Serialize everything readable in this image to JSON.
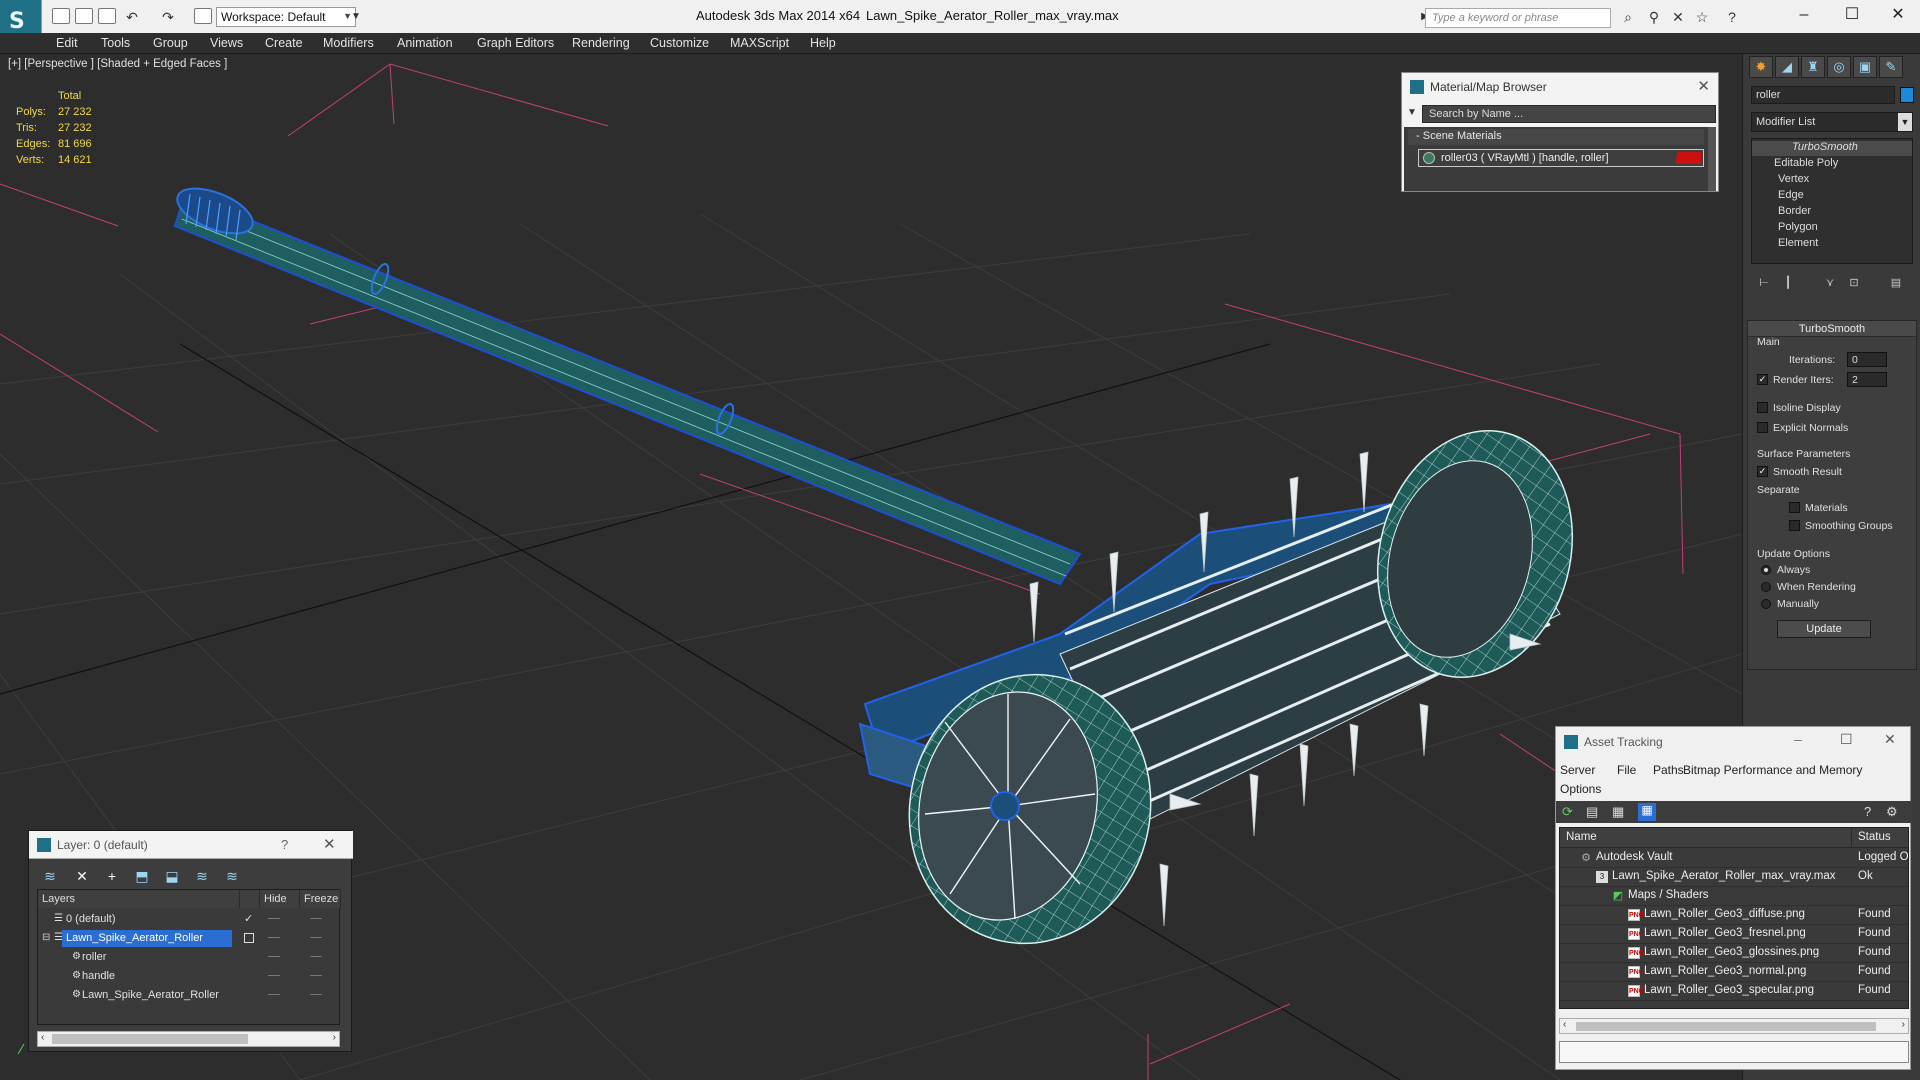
{
  "titlebar": {
    "app_title": "Autodesk 3ds Max  2014 x64",
    "file_title": "Lawn_Spike_Aerator_Roller_max_vray.max",
    "workspace_label": "Workspace: Default",
    "search_placeholder": "Type a keyword or phrase"
  },
  "menu": [
    "Edit",
    "Tools",
    "Group",
    "Views",
    "Create",
    "Modifiers",
    "Animation",
    "Graph Editors",
    "Rendering",
    "Customize",
    "MAXScript",
    "Help"
  ],
  "viewport": {
    "label": "[+] [Perspective ] [Shaded + Edged Faces ]",
    "stats": {
      "header": "Total",
      "polys_label": "Polys:",
      "polys": "27 232",
      "tris_label": "Tris:",
      "tris": "27 232",
      "edges_label": "Edges:",
      "edges": "81 696",
      "verts_label": "Verts:",
      "verts": "14 621"
    }
  },
  "material_browser": {
    "title": "Material/Map Browser",
    "search_placeholder": "Search by Name ...",
    "section": "Scene Materials",
    "material": "roller03  ( VRayMtl )  [handle, roller]"
  },
  "command_panel": {
    "object_name": "roller",
    "object_color": "#1c8ad8",
    "modifier_list": "Modifier List",
    "stack": [
      "TurboSmooth",
      "Editable Poly",
      "Vertex",
      "Edge",
      "Border",
      "Polygon",
      "Element"
    ],
    "rollout_title": "TurboSmooth",
    "main_label": "Main",
    "iterations_label": "Iterations:",
    "iterations": "0",
    "render_iters_label": "Render Iters:",
    "render_iters": "2",
    "isoline": "Isoline Display",
    "explicit_normals": "Explicit Normals",
    "surface_params": "Surface Parameters",
    "smooth_result": "Smooth Result",
    "separate": "Separate",
    "materials": "Materials",
    "smoothing_groups": "Smoothing Groups",
    "update_options": "Update Options",
    "always": "Always",
    "when_rendering": "When Rendering",
    "manually": "Manually",
    "update_btn": "Update"
  },
  "layer_panel": {
    "title": "Layer: 0 (default)",
    "help": "?",
    "col_layers": "Layers",
    "col_hide": "Hide",
    "col_freeze": "Freeze",
    "rows": [
      {
        "name": "0 (default)"
      },
      {
        "name": "Lawn_Spike_Aerator_Roller"
      },
      {
        "name": "roller"
      },
      {
        "name": "handle"
      },
      {
        "name": "Lawn_Spike_Aerator_Roller"
      }
    ]
  },
  "asset_tracking": {
    "title": "Asset Tracking",
    "menu": [
      "Server",
      "File",
      "Paths",
      "Bitmap Performance and Memory",
      "Options"
    ],
    "col_name": "Name",
    "col_status": "Status",
    "rows": [
      {
        "name": "Autodesk Vault",
        "status": "Logged O"
      },
      {
        "name": "Lawn_Spike_Aerator_Roller_max_vray.max",
        "status": "Ok"
      },
      {
        "name": "Maps / Shaders",
        "status": ""
      },
      {
        "name": "Lawn_Roller_Geo3_diffuse.png",
        "status": "Found"
      },
      {
        "name": "Lawn_Roller_Geo3_fresnel.png",
        "status": "Found"
      },
      {
        "name": "Lawn_Roller_Geo3_glossines.png",
        "status": "Found"
      },
      {
        "name": "Lawn_Roller_Geo3_normal.png",
        "status": "Found"
      },
      {
        "name": "Lawn_Roller_Geo3_specular.png",
        "status": "Found"
      }
    ]
  }
}
